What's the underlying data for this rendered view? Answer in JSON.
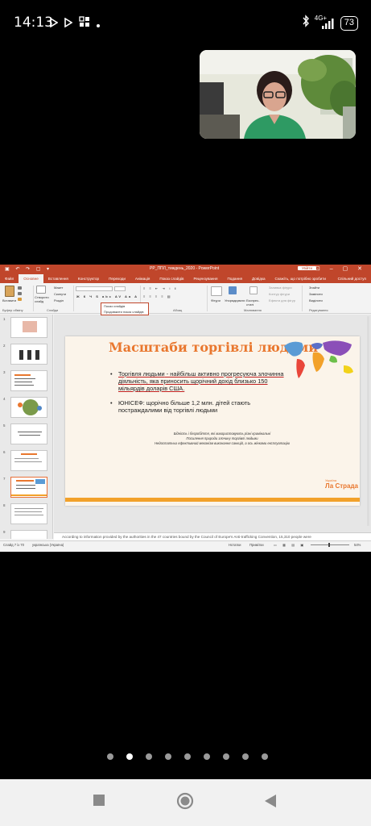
{
  "status_bar": {
    "time": "14:13",
    "battery": "73",
    "net_type": "4G+",
    "left_icons": [
      "play-outline-icon",
      "play-outline-icon",
      "apps-grid-icon",
      "dot-icon"
    ],
    "right_icons": [
      "bluetooth-icon",
      "signal-icon",
      "battery-icon"
    ]
  },
  "ppt": {
    "window_title": "PP_ППЛ_тиждень_2020 - PowerPoint",
    "signin": "Увійти",
    "tabs": [
      "Файл",
      "Основне",
      "Вставлення",
      "Конструктор",
      "Переходи",
      "Анімація",
      "Показ слайдів",
      "Рецензування",
      "Подання",
      "Довідка",
      "Скажіть, що потрібно зробити"
    ],
    "active_tab": "Основне",
    "share": "Спільний доступ",
    "ribbon": {
      "paste": "Вставити",
      "clipboard_group": "Буфер обміну",
      "new_slide": "Створити слайд",
      "layout": "Макет",
      "reset": "Скинути",
      "section": "Розділ",
      "slides_group": "Слайди",
      "paragraph_group": "Абзац",
      "shapes": "Фігури",
      "arrange": "Упорядкувати",
      "quick_styles": "Експрес-стилі",
      "shape_fill": "Заливка фігури",
      "shape_outline": "Контур фігури",
      "shape_effects": "Ефекти для фігур",
      "drawing_group": "Малювання",
      "find": "Знайти",
      "replace": "Замінити",
      "select": "Виділити",
      "editing_group": "Редагування"
    },
    "dropdown": {
      "value": "Показ слайдів",
      "item": "Продовжити показ слайдів"
    },
    "thumbnails": [
      "1",
      "2",
      "3",
      "4",
      "5",
      "6",
      "7",
      "8",
      "9"
    ],
    "selected_thumbnail": "7",
    "slide": {
      "title": "Масштаби торгівлі людьми",
      "bullet1_a": "Торгівля людьми",
      "bullet1_b": " - найбільш активно прогресуюча злочинна діяльність, яка приносить щорічний дохід близько 150 мільярдів доларів США.",
      "bullet2": "ЮНІСЕФ: щорічно більше 1,2 млн. дітей стають постраждалими від  торгівлі людьми",
      "small1": "Бідність і безробіття, які використовують різні кримінальні",
      "small2": "Посилення природи злочину торгівлі людьми",
      "small3": "Недостатньо ефективний механізм виконання санкцій, а ось жінками експлуатацію",
      "logo_top": "Україна",
      "logo": "Ла Страда"
    },
    "notes": "According to information provided by the authorities in the 47 countries bound by the Council of Europe's Anti-trafficking Convention, 15,310 people were",
    "statusbar": {
      "slide_of": "Слайд 7 із 70",
      "language": "українська (Україна)",
      "notes_btn": "Нотатки",
      "comments_btn": "Примітки",
      "zoom": "54%"
    }
  },
  "pager": {
    "count": 9,
    "active_index": 1
  },
  "navbar": {
    "icons": [
      "recents-square-icon",
      "home-circle-icon",
      "back-triangle-icon"
    ]
  }
}
